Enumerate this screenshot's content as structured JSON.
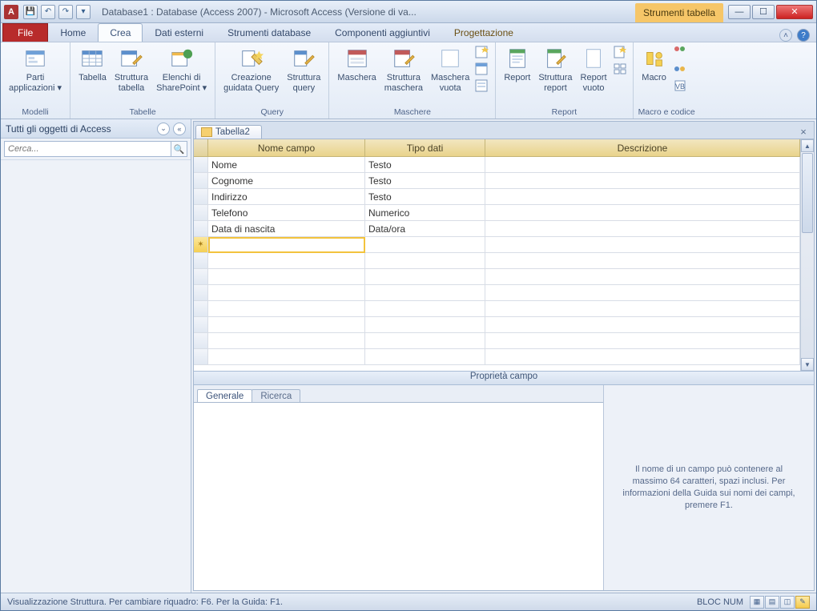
{
  "titlebar": {
    "app_letter": "A",
    "title": "Database1 : Database (Access 2007) - Microsoft Access (Versione di va...",
    "context_label": "Strumenti tabella"
  },
  "ribbon_tabs": {
    "file": "File",
    "home": "Home",
    "crea": "Crea",
    "dati_esterni": "Dati esterni",
    "strumenti_db": "Strumenti database",
    "componenti": "Componenti aggiuntivi",
    "progettazione": "Progettazione"
  },
  "ribbon": {
    "groups": {
      "modelli": {
        "label": "Modelli",
        "parti": "Parti\napplicazioni ▾"
      },
      "tabelle": {
        "label": "Tabelle",
        "tabella": "Tabella",
        "struttura": "Struttura\ntabella",
        "sharepoint": "Elenchi di\nSharePoint ▾"
      },
      "query": {
        "label": "Query",
        "wizard": "Creazione\nguidata Query",
        "struttura": "Struttura\nquery"
      },
      "maschere": {
        "label": "Maschere",
        "maschera": "Maschera",
        "struttura": "Struttura\nmaschera",
        "vuota": "Maschera\nvuota"
      },
      "report": {
        "label": "Report",
        "report": "Report",
        "struttura": "Struttura\nreport",
        "vuoto": "Report\nvuoto"
      },
      "macro": {
        "label": "Macro e codice",
        "macro": "Macro"
      }
    }
  },
  "navpane": {
    "header": "Tutti gli oggetti di Access",
    "search_placeholder": "Cerca..."
  },
  "document": {
    "tab": "Tabella2",
    "columns": {
      "name": "Nome campo",
      "type": "Tipo dati",
      "desc": "Descrizione"
    },
    "rows": [
      {
        "name": "Nome",
        "type": "Testo",
        "desc": ""
      },
      {
        "name": "Cognome",
        "type": "Testo",
        "desc": ""
      },
      {
        "name": "Indirizzo",
        "type": "Testo",
        "desc": ""
      },
      {
        "name": "Telefono",
        "type": "Numerico",
        "desc": ""
      },
      {
        "name": "Data di nascita",
        "type": "Data/ora",
        "desc": ""
      }
    ],
    "props_label": "Proprietà campo",
    "prop_tabs": {
      "generale": "Generale",
      "ricerca": "Ricerca"
    },
    "help_text": "Il nome di un campo può contenere al massimo 64 caratteri, spazi inclusi. Per informazioni della Guida sui nomi dei campi, premere F1."
  },
  "statusbar": {
    "left": "Visualizzazione Struttura. Per cambiare riquadro: F6. Per la Guida: F1.",
    "numlock": "BLOC NUM"
  }
}
